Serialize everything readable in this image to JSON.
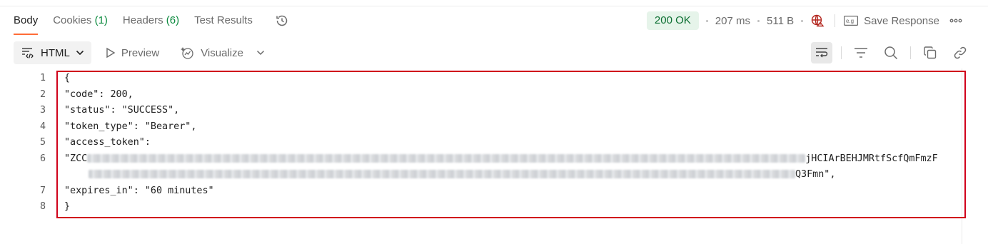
{
  "tabs": [
    {
      "label": "Body",
      "count": ""
    },
    {
      "label": "Cookies",
      "count": "(1)"
    },
    {
      "label": "Headers",
      "count": "(6)"
    },
    {
      "label": "Test Results",
      "count": ""
    }
  ],
  "response_meta": {
    "status": "200 OK",
    "time": "207 ms",
    "size": "511 B",
    "save_label": "Save Response"
  },
  "toolbar": {
    "format": "HTML",
    "preview_label": "Preview",
    "visualize_label": "Visualize"
  },
  "code_lines": [
    {
      "n": "1",
      "text": "{"
    },
    {
      "n": "2",
      "text": "\"code\": 200,"
    },
    {
      "n": "3",
      "text": "\"status\": \"SUCCESS\","
    },
    {
      "n": "4",
      "text": "\"token_type\": \"Bearer\","
    },
    {
      "n": "5",
      "text": "\"access_token\":"
    },
    {
      "n": "6",
      "text_prefix": "\"ZCC",
      "text_suffix": "jHCIArBEHJMRtfScfQmFmzF",
      "text_cont_suffix": "Q3Fmn\","
    },
    {
      "n": "7",
      "text": "\"expires_in\": \"60 minutes\""
    },
    {
      "n": "8",
      "text": "}"
    }
  ],
  "colors": {
    "accent": "#ff6c37",
    "status_ok": "#0b6e31",
    "highlight": "#d0021b"
  },
  "icons": [
    "history-icon",
    "globe-icon",
    "save-response-icon",
    "more-icon",
    "format-icon",
    "chevron-down-icon",
    "play-icon",
    "visualize-icon",
    "wrap-lines-icon",
    "filter-icon",
    "search-icon",
    "copy-icon",
    "link-icon"
  ]
}
